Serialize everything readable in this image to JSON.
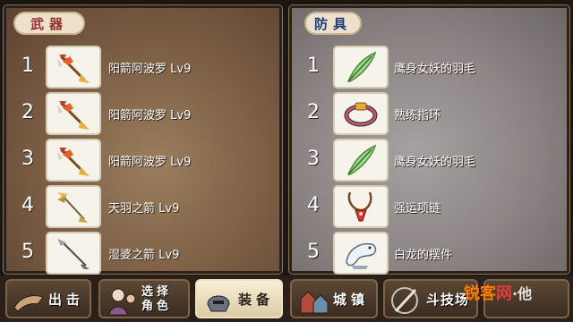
{
  "weapons": {
    "title": "武器",
    "items": [
      {
        "rank": "1",
        "name": "阳箭阿波罗 Lv9",
        "icon": "flame-arrow-icon"
      },
      {
        "rank": "2",
        "name": "阳箭阿波罗 Lv9",
        "icon": "flame-arrow-icon"
      },
      {
        "rank": "3",
        "name": "阳箭阿波罗 Lv9",
        "icon": "flame-arrow-icon"
      },
      {
        "rank": "4",
        "name": "天羽之箭 Lv9",
        "icon": "golden-arrow-icon"
      },
      {
        "rank": "5",
        "name": "湿婆之箭 Lv9",
        "icon": "silver-arrow-icon"
      }
    ]
  },
  "armor": {
    "title": "防具",
    "items": [
      {
        "rank": "1",
        "name": "鹰身女妖的羽毛",
        "icon": "green-feather-icon"
      },
      {
        "rank": "2",
        "name": "熟练指环",
        "icon": "ring-icon"
      },
      {
        "rank": "3",
        "name": "鹰身女妖的羽毛",
        "icon": "green-feather-icon"
      },
      {
        "rank": "4",
        "name": "强运项链",
        "icon": "necklace-icon"
      },
      {
        "rank": "5",
        "name": "白龙的摆件",
        "icon": "white-dragon-icon"
      }
    ]
  },
  "nav": {
    "sortie": "出击",
    "select_role_line1": "选择",
    "select_role_line2": "角色",
    "equip": "装备",
    "town": "城镇",
    "arena": "斗技场"
  },
  "watermark": {
    "part1": "锐客",
    "part2": "网",
    "part3": "·他"
  },
  "colors": {
    "weapons_title": "#9a2a2a",
    "armor_title": "#1c3b7a",
    "active_tab": "#f3e8cf"
  }
}
